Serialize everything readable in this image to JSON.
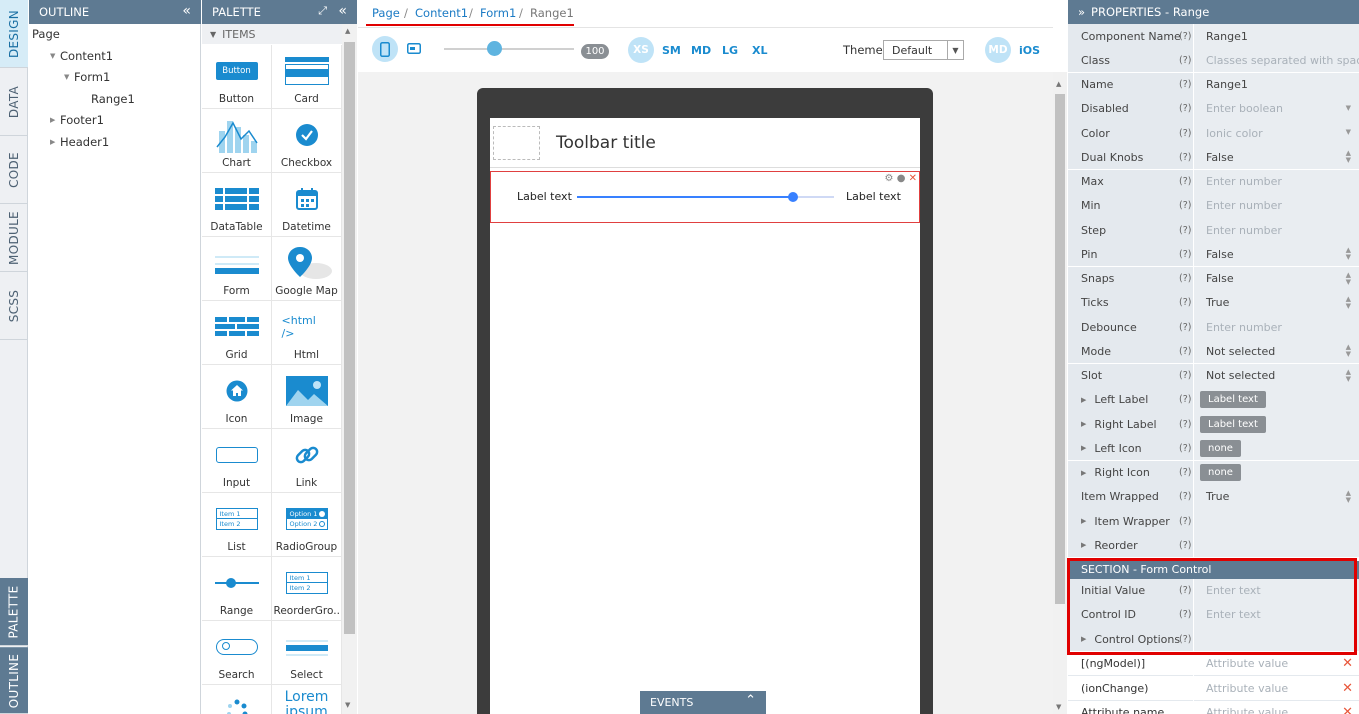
{
  "vtabs": [
    "DESIGN",
    "DATA",
    "CODE",
    "MODULE",
    "SCSS"
  ],
  "vtabs_bottom": [
    "PALETTE",
    "OUTLINE"
  ],
  "outline": {
    "title": "OUTLINE",
    "tree": [
      "Page",
      "Content1",
      "Form1",
      "Range1",
      "Footer1",
      "Header1"
    ]
  },
  "palette": {
    "title": "PALETTE",
    "section": "ITEMS",
    "items": [
      "Button",
      "Card",
      "Chart",
      "Checkbox",
      "DataTable",
      "Datetime",
      "Form",
      "Google Map",
      "Grid",
      "Html",
      "Icon",
      "Image",
      "Input",
      "Link",
      "List",
      "RadioGroup",
      "Range",
      "ReorderGro...",
      "Search",
      "Select"
    ],
    "icon_texts": {
      "button": "Button",
      "html": "<html />",
      "lorem": "Lorem ipsum",
      "item1": "Item 1",
      "item2": "Item 2",
      "option1": "Option 1",
      "option2": "Option 2"
    }
  },
  "breadcrumb": [
    "Page",
    "Form1",
    "Content1",
    "Range1"
  ],
  "breadcrumb_sep": "/",
  "toolbar": {
    "zoom": "100",
    "breakpoints": [
      "XS",
      "SM",
      "MD",
      "LG",
      "XL"
    ],
    "theme_label": "Theme:",
    "theme_value": "Default",
    "platforms": [
      "MD",
      "iOS"
    ]
  },
  "device": {
    "toolbar_title": "Toolbar title",
    "left_label": "Label text",
    "right_label": "Label text",
    "range_value": 0.84
  },
  "events_label": "EVENTS",
  "properties": {
    "title": "PROPERTIES - Range",
    "rows": [
      {
        "label": "Component Name",
        "value": "Range1"
      },
      {
        "label": "Class",
        "value": "Classes separated with space",
        "ph": true
      },
      {
        "label": "Name",
        "value": "Range1"
      },
      {
        "label": "Disabled",
        "value": "Enter boolean",
        "ph": true,
        "dd": true
      },
      {
        "label": "Color",
        "value": "Ionic color",
        "ph": true,
        "dd": true
      },
      {
        "label": "Dual Knobs",
        "value": "False",
        "ud": true
      },
      {
        "label": "Max",
        "value": "Enter number",
        "ph": true
      },
      {
        "label": "Min",
        "value": "Enter number",
        "ph": true
      },
      {
        "label": "Step",
        "value": "Enter number",
        "ph": true
      },
      {
        "label": "Pin",
        "value": "False",
        "ud": true
      },
      {
        "label": "Snaps",
        "value": "False",
        "ud": true
      },
      {
        "label": "Ticks",
        "value": "True",
        "ud": true
      },
      {
        "label": "Debounce",
        "value": "Enter number",
        "ph": true
      },
      {
        "label": "Mode",
        "value": "Not selected",
        "ud": true
      },
      {
        "label": "Slot",
        "value": "Not selected",
        "ud": true
      },
      {
        "label": "Left Label",
        "chip": "Label text",
        "exp": true
      },
      {
        "label": "Right Label",
        "chip": "Label text",
        "exp": true
      },
      {
        "label": "Left Icon",
        "chip": "none",
        "exp": true
      },
      {
        "label": "Right Icon",
        "chip": "none",
        "exp": true
      },
      {
        "label": "Item Wrapped",
        "value": "True",
        "ud": true
      },
      {
        "label": "Item Wrapper",
        "exp": true,
        "value": ""
      },
      {
        "label": "Reorder",
        "exp": true,
        "value": ""
      }
    ],
    "section": "SECTION - Form Control",
    "section_rows": [
      {
        "label": "Initial Value",
        "value": "Enter text",
        "ph": true
      },
      {
        "label": "Control ID",
        "value": "Enter text",
        "ph": true
      },
      {
        "label": "Control Options",
        "exp": true,
        "value": ""
      }
    ],
    "attr_rows": [
      {
        "label": "[(ngModel)]",
        "value": "Attribute value"
      },
      {
        "label": "(ionChange)",
        "value": "Attribute value"
      },
      {
        "label": "Attribute name",
        "value": "Attribute value"
      }
    ],
    "help": "(?)"
  },
  "colors": {
    "header": "#5e7a92",
    "accent": "#1a8bcf",
    "highlight": "#e00000"
  }
}
